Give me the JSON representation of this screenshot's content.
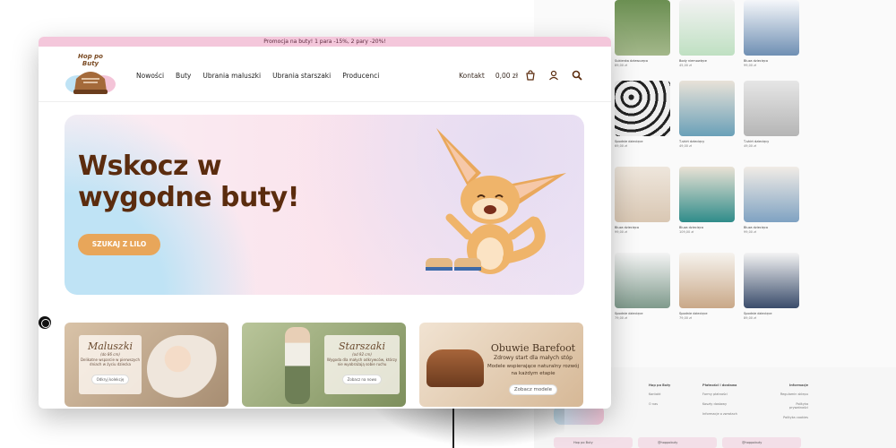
{
  "promo_bar": "Promocja na buty! 1 para -15%, 2 pary -20%!",
  "header": {
    "logo_text": "Hop po Buty",
    "nav": [
      "Nowości",
      "Buty",
      "Ubrania maluszki",
      "Ubrania starszaki",
      "Producenci"
    ],
    "contact": "Kontakt",
    "cart_total": "0,00 zł"
  },
  "hero": {
    "title": "Wskocz w wygodne buty!",
    "cta": "SZUKAJ Z LILO"
  },
  "cards": [
    {
      "title": "Maluszki",
      "subtitle": "(do 86 cm)",
      "desc": "Delikatne wsparcie w pierwszych dniach w życiu dziecka",
      "button": "Odkryj kolekcję"
    },
    {
      "title": "Starszaki",
      "subtitle": "(od 92 cm)",
      "desc": "Wygoda dla małych odkrywców, którzy nie wyobrażają sobie ruchu",
      "button": "Zobacz na nowo"
    },
    {
      "title": "Obuwie Barefoot",
      "subtitle": "Zdrowy start dla małych stóp",
      "desc": "Modele wspierające naturalny rozwój na każdym etapie",
      "button": "Zobacz modele"
    }
  ],
  "colors": {
    "promo_bg": "#f4c7db",
    "heading_brown": "#5b2c0e",
    "cta_orange": "#e8a65a"
  },
  "back_products": [
    {
      "name": "Sukienka dziewczęca",
      "price": "89,00 zł"
    },
    {
      "name": "Body niemowlęce",
      "price": "45,00 zł"
    },
    {
      "name": "Bluza dziecięca",
      "price": "99,00 zł"
    },
    {
      "name": "Spodnie dziecięce",
      "price": "69,00 zł"
    },
    {
      "name": "T-shirt dziecięcy",
      "price": "49,00 zł"
    },
    {
      "name": "T-shirt dziecięcy",
      "price": "49,00 zł"
    },
    {
      "name": "Bluza dziecięca",
      "price": "99,00 zł"
    },
    {
      "name": "Bluza dziecięca",
      "price": "109,00 zł"
    },
    {
      "name": "Bluza dziecięca",
      "price": "99,00 zł"
    },
    {
      "name": "Spodnie dziecięce",
      "price": "79,00 zł"
    },
    {
      "name": "Spodnie dziecięce",
      "price": "79,00 zł"
    },
    {
      "name": "Spodnie dziecięce",
      "price": "89,00 zł"
    }
  ],
  "footer": {
    "col1_title": "Hop po Buty",
    "col1_links": [
      "Kontakt",
      "O nas"
    ],
    "col2_title": "Płatności i dostawa",
    "col2_links": [
      "Formy płatności",
      "Koszty dostawy",
      "Informacje o zwrotach"
    ],
    "col3_title": "Informacje",
    "col3_links": [
      "Regulamin sklepu",
      "Polityka prywatności",
      "Polityka cookies"
    ],
    "social": [
      "Hop po Buty",
      "@hoppobuty",
      "@hoppobuty"
    ]
  }
}
